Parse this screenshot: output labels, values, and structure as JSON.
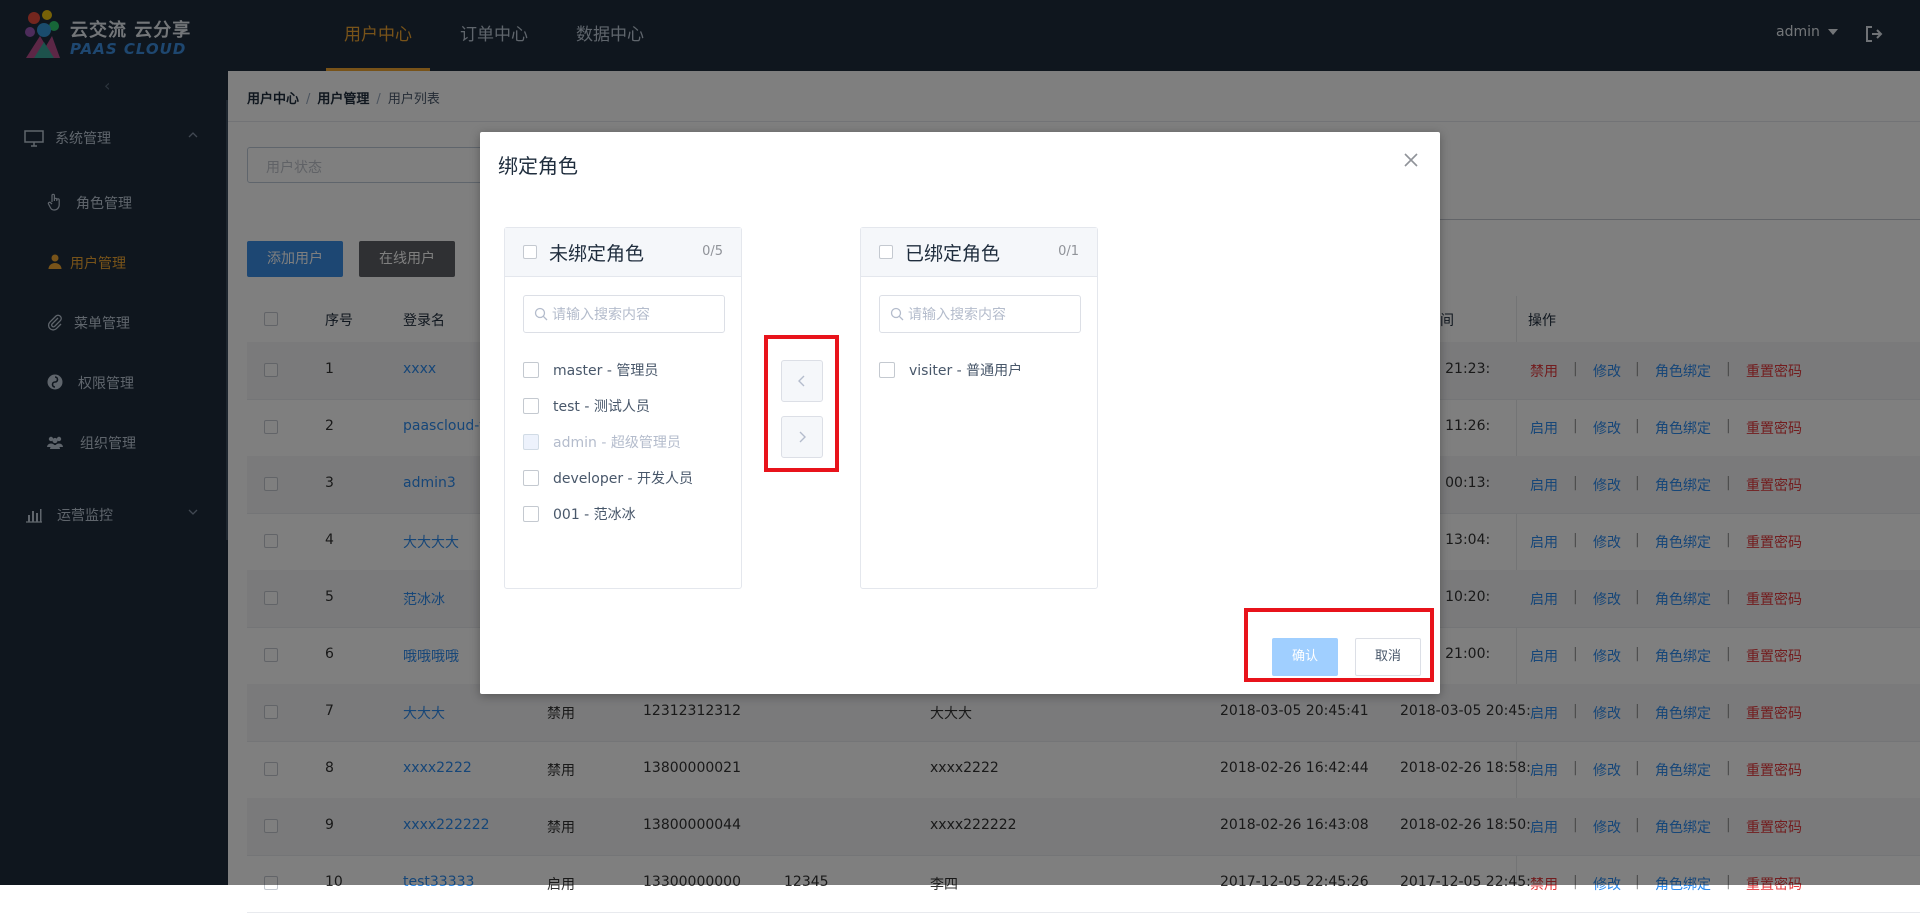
{
  "app": {
    "logo_cn": "云交流 云分享",
    "logo_en": "PAAS CLOUD",
    "nav": [
      "用户中心",
      "订单中心",
      "数据中心"
    ],
    "active_nav": 0,
    "user": "admin"
  },
  "sidebar": {
    "groups": [
      {
        "label": "系统管理",
        "icon": "monitor-icon",
        "expanded": true
      },
      {
        "label": "运营监控",
        "icon": "bar-chart-icon",
        "expanded": false
      }
    ],
    "items": [
      {
        "label": "角色管理",
        "icon": "hand-pointer-icon"
      },
      {
        "label": "用户管理",
        "icon": "user-icon",
        "active": true
      },
      {
        "label": "菜单管理",
        "icon": "paperclip-icon"
      },
      {
        "label": "权限管理",
        "icon": "permission-icon"
      },
      {
        "label": "组织管理",
        "icon": "group-icon"
      }
    ]
  },
  "breadcrumb": [
    "用户中心",
    "用户管理",
    "用户列表"
  ],
  "filters": {
    "status_placeholder": "用户状态"
  },
  "toolbar": {
    "add_user": "添加用户",
    "online_users": "在线用户"
  },
  "table": {
    "headers": {
      "index": "序号",
      "login": "登录名",
      "time_partial": "间",
      "ops": "操作"
    },
    "ops": {
      "disable": "禁用",
      "enable": "启用",
      "edit": "修改",
      "bind_role": "角色绑定",
      "reset_pwd": "重置密码",
      "sep": "|"
    },
    "rows": [
      {
        "idx": "1",
        "login": "xxxx",
        "time2": "03-13 21:23:",
        "toggle": "禁用"
      },
      {
        "idx": "2",
        "login": "paascloud-te",
        "time2": "03-13 11:26:",
        "toggle": "启用"
      },
      {
        "idx": "3",
        "login": "admin3",
        "time2": "03-13 00:13:",
        "toggle": "启用"
      },
      {
        "idx": "4",
        "login": "大大大大",
        "time2": "03-12 13:04:",
        "toggle": "启用"
      },
      {
        "idx": "5",
        "login": "范冰冰",
        "time2": "03-12 10:20:",
        "toggle": "启用"
      },
      {
        "idx": "6",
        "login": "哦哦哦哦",
        "time2": "03-05 21:00:",
        "toggle": "启用"
      },
      {
        "idx": "7",
        "login": "大大大",
        "status": "禁用",
        "phone": "12312312312",
        "name": "大大大",
        "time1": "2018-03-05 20:45:41",
        "time2": "2018-03-05 20:45:",
        "toggle": "启用"
      },
      {
        "idx": "8",
        "login": "xxxx2222",
        "status": "禁用",
        "phone": "13800000021",
        "name": "xxxx2222",
        "time1": "2018-02-26 16:42:44",
        "time2": "2018-02-26 18:58:",
        "toggle": "启用"
      },
      {
        "idx": "9",
        "login": "xxxx222222",
        "status": "禁用",
        "phone": "13800000044",
        "name": "xxxx222222",
        "time1": "2018-02-26 16:43:08",
        "time2": "2018-02-26 18:50:",
        "toggle": "启用"
      },
      {
        "idx": "10",
        "login": "test33333",
        "status": "启用",
        "phone": "13300000000",
        "name": "李四",
        "time1": "2017-12-05 22:45:26",
        "time2": "2017-12-05 22:45:",
        "toggle": "禁用",
        "extra": "12345"
      }
    ]
  },
  "dialog": {
    "title": "绑定角色",
    "left": {
      "title": "未绑定角色",
      "count": "0/5",
      "search_placeholder": "请输入搜索内容",
      "options": [
        {
          "label": "master - 管理员",
          "disabled": false
        },
        {
          "label": "test - 测试人员",
          "disabled": false
        },
        {
          "label": "admin - 超级管理员",
          "disabled": true
        },
        {
          "label": "developer - 开发人员",
          "disabled": false
        },
        {
          "label": "001 - 范冰冰",
          "disabled": false
        }
      ]
    },
    "right": {
      "title": "已绑定角色",
      "count": "0/1",
      "search_placeholder": "请输入搜索内容",
      "options": [
        {
          "label": "visiter - 普通用户",
          "disabled": false
        }
      ]
    },
    "confirm": "确认",
    "cancel": "取消",
    "highlight_color": "#e8131b"
  }
}
